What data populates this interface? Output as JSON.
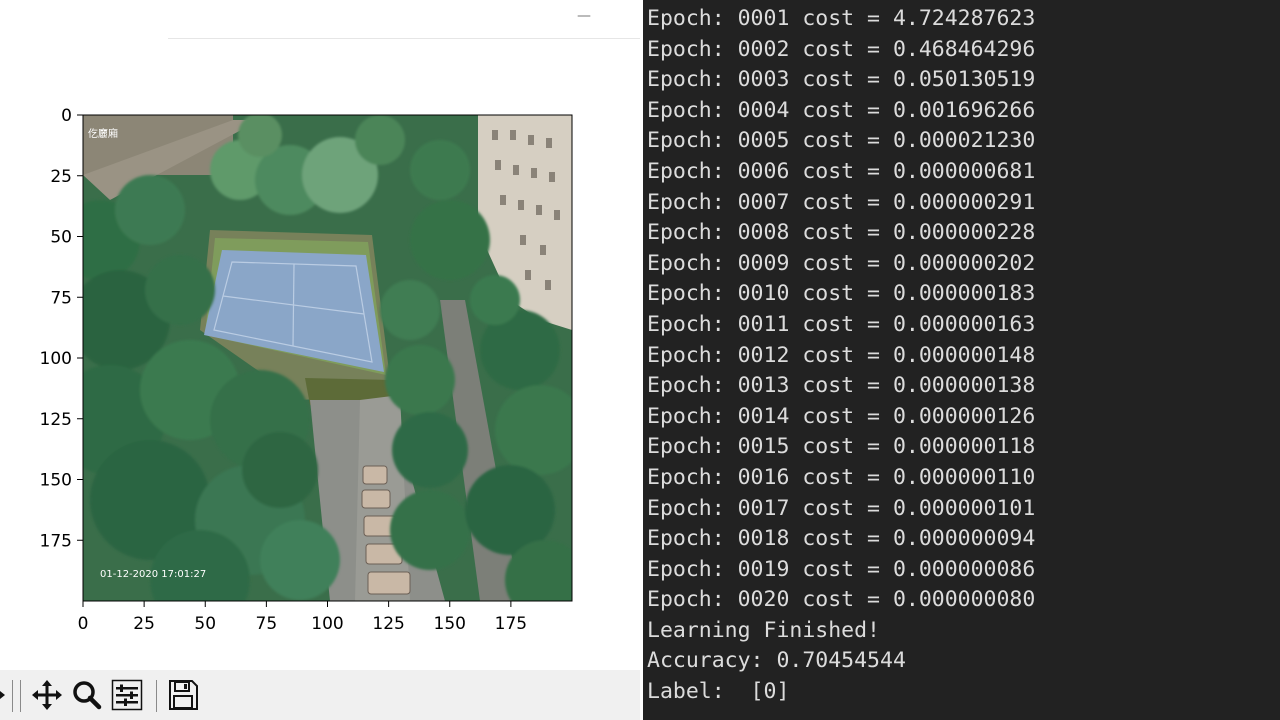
{
  "window": {
    "minimize_glyph": "—"
  },
  "plot": {
    "y_ticks": [
      "0",
      "25",
      "50",
      "75",
      "100",
      "125",
      "150",
      "175"
    ],
    "x_ticks": [
      "0",
      "25",
      "50",
      "75",
      "100",
      "125",
      "150",
      "175"
    ],
    "image": {
      "content": "aerial photo of a building complex courtyard with a blue tennis court, trees and parked cars",
      "overlay_top_left": "仡廲廂",
      "overlay_bottom_left": "01-12-2020 17:01:27",
      "colors": {
        "tree": "#2f6e45",
        "tree_light": "#5f9a6a",
        "court": "#8aa6c8",
        "road": "#8d8f8a",
        "building": "#d8d2c6",
        "car": "#c9b8a6"
      }
    }
  },
  "toolbar": {
    "icons": [
      "pan-icon",
      "zoom-icon",
      "subplots-icon",
      "save-icon"
    ]
  },
  "terminal": {
    "lines": [
      "Epoch: 0001 cost = 4.724287623",
      "Epoch: 0002 cost = 0.468464296",
      "Epoch: 0003 cost = 0.050130519",
      "Epoch: 0004 cost = 0.001696266",
      "Epoch: 0005 cost = 0.000021230",
      "Epoch: 0006 cost = 0.000000681",
      "Epoch: 0007 cost = 0.000000291",
      "Epoch: 0008 cost = 0.000000228",
      "Epoch: 0009 cost = 0.000000202",
      "Epoch: 0010 cost = 0.000000183",
      "Epoch: 0011 cost = 0.000000163",
      "Epoch: 0012 cost = 0.000000148",
      "Epoch: 0013 cost = 0.000000138",
      "Epoch: 0014 cost = 0.000000126",
      "Epoch: 0015 cost = 0.000000118",
      "Epoch: 0016 cost = 0.000000110",
      "Epoch: 0017 cost = 0.000000101",
      "Epoch: 0018 cost = 0.000000094",
      "Epoch: 0019 cost = 0.000000086",
      "Epoch: 0020 cost = 0.000000080",
      "Learning Finished!",
      "Accuracy: 0.70454544",
      "Label:  [0]"
    ],
    "text_color": "#dcdcdc",
    "background": "#222222"
  }
}
